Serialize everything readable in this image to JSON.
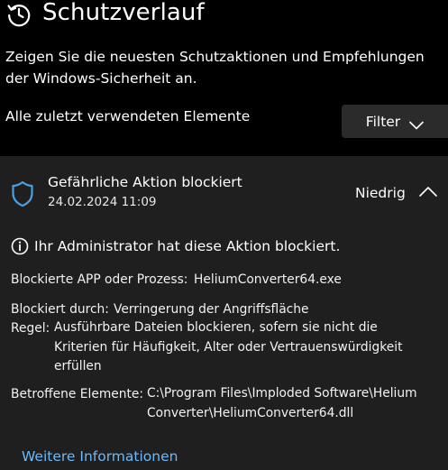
{
  "header": {
    "title": "Schutzverlauf"
  },
  "description": "Zeigen Sie die neuesten Schutzaktionen und Empfehlungen der Windows-Sicherheit an.",
  "recent": {
    "label": "Alle zuletzt verwendeten Elemente"
  },
  "filter": {
    "label": "Filter"
  },
  "card": {
    "title": "Gefährliche Aktion blockiert",
    "date": "24.02.2024 11:09",
    "severity": "Niedrig",
    "admin_message": "Ihr Administrator hat diese Aktion blockiert.",
    "blocked_app_label": "Blockierte APP oder Prozess:",
    "blocked_app_value": "HeliumConverter64.exe",
    "blocked_by_label": "Blockiert durch:",
    "blocked_by_value": "Verringerung der Angriffsfläche",
    "rule_label": "Regel:",
    "rule_value": "Ausführbare Dateien blockieren, sofern sie nicht die Kriterien für Häufigkeit, Alter oder Vertrauenswürdigkeit erfüllen",
    "affected_label": "Betroffene Elemente:",
    "affected_value": "C:\\Program Files\\Imploded Software\\Helium Converter\\HeliumConverter64.dll",
    "more_info": "Weitere Informationen"
  },
  "colors": {
    "background": "#000000",
    "card": "#1f1f1f",
    "button": "#2b2b2b",
    "link": "#6cb8f6",
    "shield": "#4ca0e0"
  },
  "icons": {
    "header": "history-icon",
    "card": "shield-icon",
    "info": "info-icon",
    "filter": "chevron-down-icon",
    "collapse": "chevron-up-icon"
  }
}
